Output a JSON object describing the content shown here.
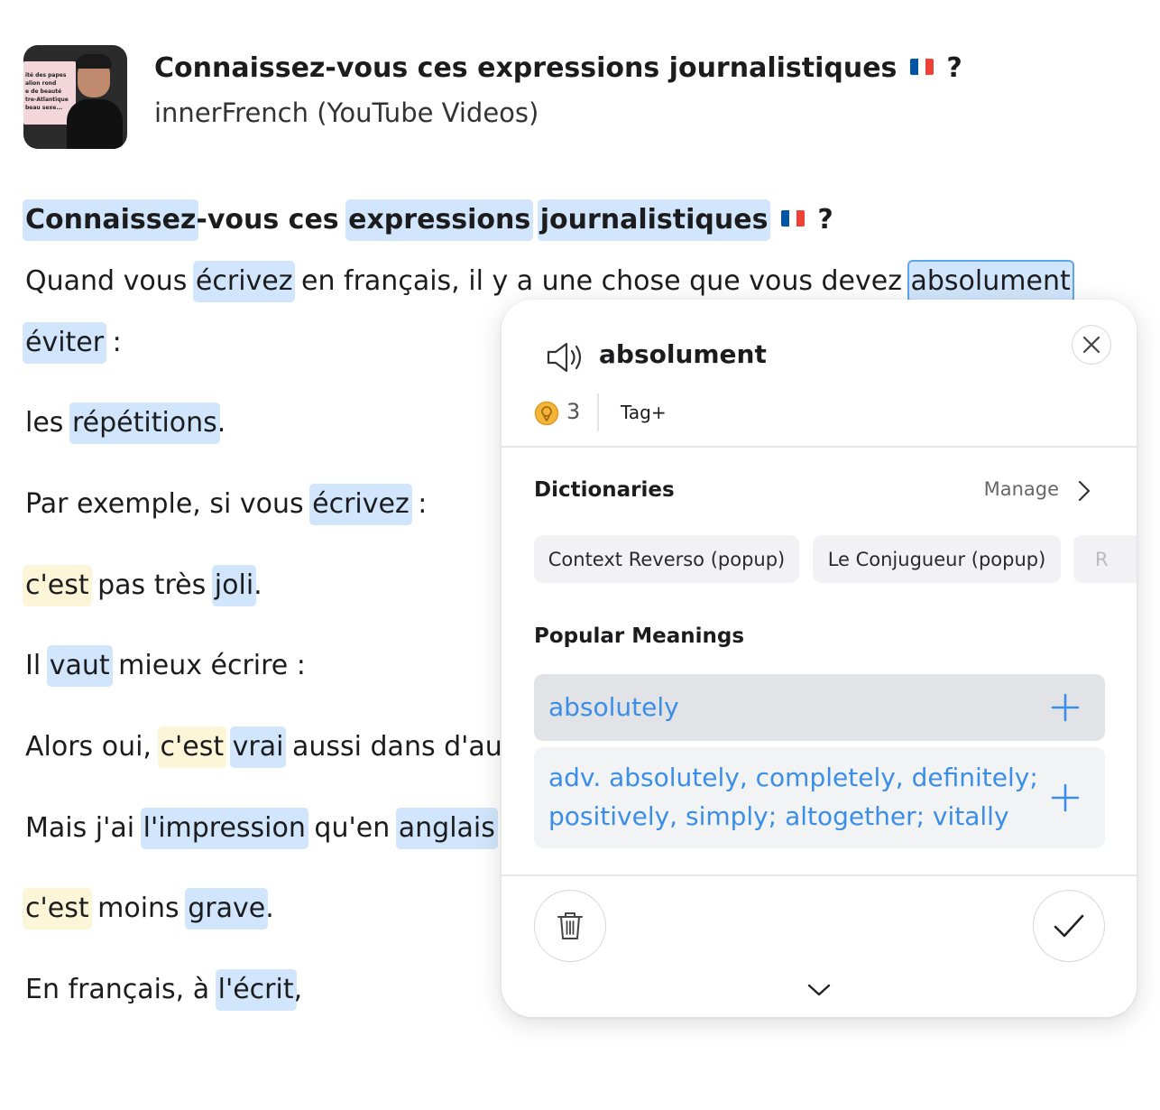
{
  "header": {
    "title": "Connaissez-vous ces expressions journalistiques",
    "title_suffix": "?",
    "subtitle": "innerFrench (YouTube Videos)",
    "thumb_lines": [
      "ité des papes",
      "alion rond",
      "e de beauté",
      "tre-Atlantique",
      "beau sexe..."
    ]
  },
  "flag_colors": [
    "#0055A4",
    "#FFFFFF",
    "#EF4135"
  ],
  "highlight_colors": {
    "known": "#d1e6fc",
    "phrase": "#fdf5d8",
    "selected_border": "#5aa6f0"
  },
  "text": {
    "p0": {
      "w1": "Connaissez",
      "t1": "-vous ces ",
      "w2": "expressions",
      "w3": "journalistiques",
      "t2": "?"
    },
    "p1": {
      "t1": "Quand vous ",
      "w1": "écrivez",
      "t2": " en français, il y a une chose que vous devez ",
      "w2": "absolument"
    },
    "p2": {
      "w1": "éviter",
      "t1": " :"
    },
    "p3": {
      "t1": "les ",
      "w1": "répétitions",
      "t2": "."
    },
    "p4": {
      "t1": "Par exemple, si vous ",
      "w1": "écrivez",
      "t2": " :"
    },
    "p5": {
      "w1": "c'est",
      "t1": " pas très ",
      "w2": "joli",
      "t2": "."
    },
    "p6": {
      "t1": "Il ",
      "w1": "vaut",
      "t2": " mieux écrire :"
    },
    "p7": {
      "t1": "Alors oui, ",
      "w1": "c'est",
      "w2": "vrai",
      "t2": " aussi dans d'au"
    },
    "p8": {
      "t1": "Mais j'ai ",
      "w1": "l'impression",
      "t2": " qu'en ",
      "w2": "anglais"
    },
    "p9": {
      "w1": "c'est",
      "t1": " moins ",
      "w2": "grave",
      "t2": "."
    },
    "p10": {
      "t1": "En français, à ",
      "w1": "l'écrit",
      "t2": ","
    }
  },
  "popup": {
    "word": "absolument",
    "count": "3",
    "tag_label": "Tag+",
    "dictionaries_title": "Dictionaries",
    "manage_label": "Manage",
    "dictionaries": [
      "Context Reverso (popup)",
      "Le Conjugueur (popup)",
      "R"
    ],
    "meanings_title": "Popular Meanings",
    "meanings": [
      "absolutely",
      "adv. absolutely, completely, definitely;",
      "positively, simply; altogether; vitally"
    ],
    "icons": [
      "speaker-icon",
      "close-icon",
      "coin-icon",
      "chevron-right-icon",
      "plus-icon",
      "trash-icon",
      "checkmark-icon",
      "chevron-down-icon"
    ],
    "colors": {
      "meaning_text": "#3b8ee8",
      "meaning_selected_bg": "#e1e3e7",
      "meaning_bg": "#f2f3f5",
      "coin": "#f4b63a"
    }
  }
}
